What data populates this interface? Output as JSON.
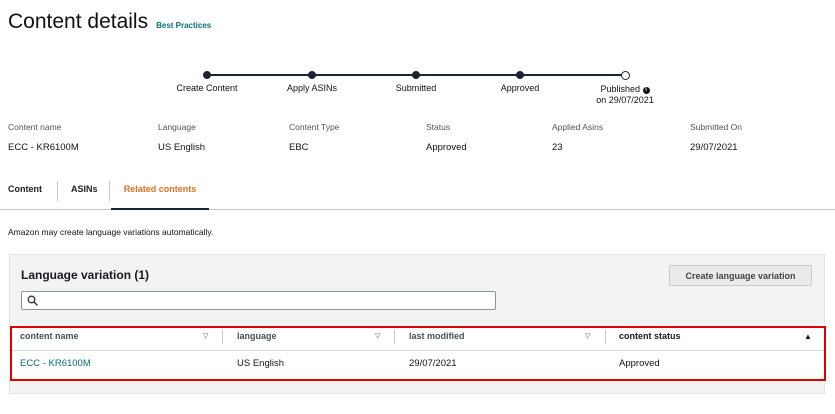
{
  "header": {
    "title": "Content details",
    "best_practices_link": "Best Practices"
  },
  "stepper": {
    "steps": [
      {
        "label": "Create Content",
        "state": "complete"
      },
      {
        "label": "Apply ASINs",
        "state": "complete"
      },
      {
        "label": "Submitted",
        "state": "complete"
      },
      {
        "label": "Approved",
        "state": "complete"
      },
      {
        "label": "Published",
        "sublabel": "on 29/07/2021",
        "state": "current",
        "icon": "info-icon"
      }
    ]
  },
  "meta": [
    {
      "label": "Content name",
      "value": "ECC - KR6100M"
    },
    {
      "label": "Language",
      "value": "US English"
    },
    {
      "label": "Content Type",
      "value": "EBC"
    },
    {
      "label": "Status",
      "value": "Approved"
    },
    {
      "label": "Applied Asins",
      "value": "23"
    },
    {
      "label": "Submitted On",
      "value": "29/07/2021"
    }
  ],
  "tabs": [
    {
      "label": "Content",
      "active": false
    },
    {
      "label": "ASINs",
      "active": false
    },
    {
      "label": "Related contents",
      "active": true
    }
  ],
  "note": "Amazon may create language variations automatically.",
  "panel": {
    "title": "Language variation (1)",
    "create_button": "Create language variation",
    "search": {
      "value": "",
      "placeholder": "",
      "icon": "search-icon"
    }
  },
  "table": {
    "columns": [
      {
        "label": "content name",
        "sort_icon": "▽"
      },
      {
        "label": "language",
        "sort_icon": "▽"
      },
      {
        "label": "last modified",
        "sort_icon": "▽"
      },
      {
        "label": "content status",
        "sort_icon": "▲"
      }
    ],
    "rows": [
      {
        "content_name": "ECC - KR6100M",
        "language": "US English",
        "last_modified": "29/07/2021",
        "content_status": "Approved"
      }
    ]
  },
  "colors": {
    "link": "#0a6e7a",
    "active_tab": "#e07020",
    "highlight_border": "#e00000",
    "stepper": "#1a2530"
  }
}
